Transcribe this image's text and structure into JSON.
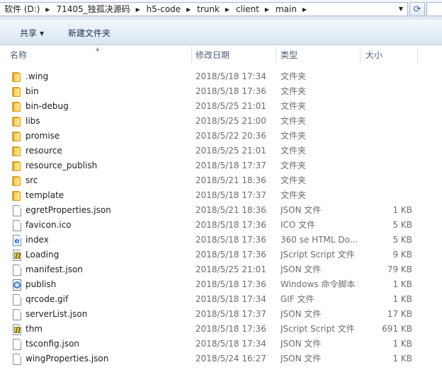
{
  "address_bar": {
    "crumbs": [
      "软件 (D:)",
      "71405_独孤决源码",
      "h5-code",
      "trunk",
      "client",
      "main"
    ]
  },
  "toolbar": {
    "share_label": "共享",
    "new_folder_label": "新建文件夹"
  },
  "columns": {
    "name": "名称",
    "date": "修改日期",
    "type": "类型",
    "size": "大小"
  },
  "files": [
    {
      "name": ".wing",
      "date": "2018/5/18 17:34",
      "type": "文件夹",
      "size": "",
      "icon": "folder-icon"
    },
    {
      "name": "bin",
      "date": "2018/5/18 17:36",
      "type": "文件夹",
      "size": "",
      "icon": "folder-icon"
    },
    {
      "name": "bin-debug",
      "date": "2018/5/25 21:01",
      "type": "文件夹",
      "size": "",
      "icon": "folder-icon"
    },
    {
      "name": "libs",
      "date": "2018/5/25 21:00",
      "type": "文件夹",
      "size": "",
      "icon": "folder-icon"
    },
    {
      "name": "promise",
      "date": "2018/5/22 20:36",
      "type": "文件夹",
      "size": "",
      "icon": "folder-icon"
    },
    {
      "name": "resource",
      "date": "2018/5/25 21:01",
      "type": "文件夹",
      "size": "",
      "icon": "folder-icon"
    },
    {
      "name": "resource_publish",
      "date": "2018/5/18 17:37",
      "type": "文件夹",
      "size": "",
      "icon": "folder-icon"
    },
    {
      "name": "src",
      "date": "2018/5/21 18:36",
      "type": "文件夹",
      "size": "",
      "icon": "folder-icon"
    },
    {
      "name": "template",
      "date": "2018/5/18 17:37",
      "type": "文件夹",
      "size": "",
      "icon": "folder-icon"
    },
    {
      "name": "egretProperties.json",
      "date": "2018/5/21 18:36",
      "type": "JSON 文件",
      "size": "1 KB",
      "icon": "document-icon"
    },
    {
      "name": "favicon.ico",
      "date": "2018/5/18 17:36",
      "type": "ICO 文件",
      "size": "5 KB",
      "icon": "document-icon"
    },
    {
      "name": "index",
      "date": "2018/5/18 17:36",
      "type": "360 se HTML Do...",
      "size": "5 KB",
      "icon": "html-document-icon"
    },
    {
      "name": "Loading",
      "date": "2018/5/18 17:36",
      "type": "JScript Script 文件",
      "size": "9 KB",
      "icon": "script-icon"
    },
    {
      "name": "manifest.json",
      "date": "2018/5/25 21:01",
      "type": "JSON 文件",
      "size": "79 KB",
      "icon": "document-icon"
    },
    {
      "name": "publish",
      "date": "2018/5/18 17:36",
      "type": "Windows 命令脚本",
      "size": "1 KB",
      "icon": "batch-script-icon"
    },
    {
      "name": "qrcode.gif",
      "date": "2018/5/18 17:34",
      "type": "GIF 文件",
      "size": "1 KB",
      "icon": "document-icon"
    },
    {
      "name": "serverList.json",
      "date": "2018/5/18 17:37",
      "type": "JSON 文件",
      "size": "17 KB",
      "icon": "document-icon"
    },
    {
      "name": "thm",
      "date": "2018/5/18 17:36",
      "type": "JScript Script 文件",
      "size": "691 KB",
      "icon": "script-icon"
    },
    {
      "name": "tsconfig.json",
      "date": "2018/5/18 17:34",
      "type": "JSON 文件",
      "size": "1 KB",
      "icon": "document-icon"
    },
    {
      "name": "wingProperties.json",
      "date": "2018/5/24 16:27",
      "type": "JSON 文件",
      "size": "1 KB",
      "icon": "document-icon"
    }
  ]
}
